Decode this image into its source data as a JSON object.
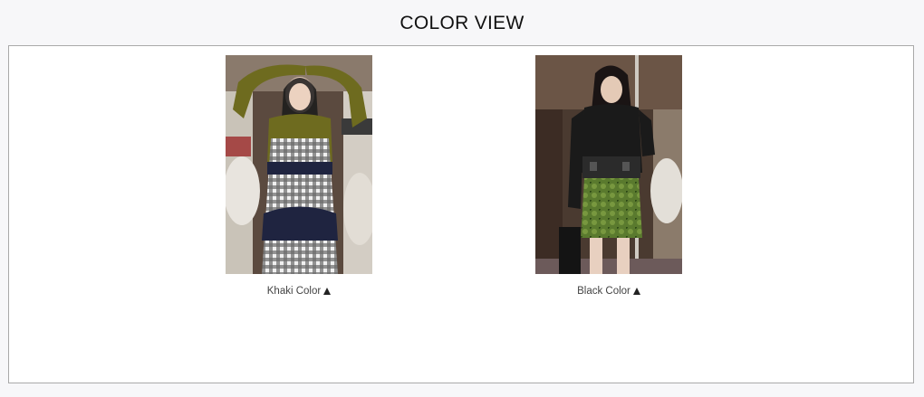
{
  "section": {
    "title": "COLOR VIEW"
  },
  "variants": [
    {
      "label": "Khaki Color",
      "icon": "triangle-up-icon",
      "accent": "#6e6b1f"
    },
    {
      "label": "Black Color",
      "icon": "triangle-up-icon",
      "accent": "#1a1a1a"
    }
  ]
}
